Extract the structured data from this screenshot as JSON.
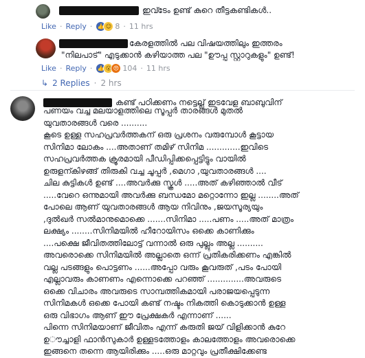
{
  "comment1": {
    "text": "ഇവ്ടേം ഉണ്ട് കുറെ തീട്ടകണ്ടികൾ..",
    "like": "Like",
    "reply": "Reply",
    "reaction_count": "8",
    "time": "11 hrs"
  },
  "comment2": {
    "lines": [
      "കേരളത്തിൽ പല വിഷയത്തിലും ഇത്തരം",
      "\"നിലപാട്\" എടുക്കാൻ കഴിയാത്ത പല \"ഊപ്പ സ്റ്റാറുകളും\" ഉണ്ട്!"
    ],
    "like": "Like",
    "reply": "Reply",
    "reaction_count": "104",
    "time": "11 hrs"
  },
  "replies_link": {
    "label": "2 Replies",
    "time": "2 hrs"
  },
  "comment3": {
    "lines": [
      "കണ്ട് പഠിക്കണം നട്ടെല്ല് ഇടവേള ബാബുവിന്",
      "പണയം വച്ച മലയാളത്തിലെ സൂപ്പർ താരങ്ങൾ മുതൽ",
      "യുവതാരങ്ങൾ വരെ ..........",
      "കൂടെ ഉള്ള സഹപ്രവർത്തകന് ഒരു പ്രശനം വരുമ്പോൾ കൂട്ടായ",
      "സിനിമാ ലോകം ....അതാണ് തമിഴ് സിനിമ .............ഇവിടെ",
      "സഹപ്രവർത്തക ക്രൂരമായി പീഡിപ്പിക്കപ്പെട്ടിട്ടും വായിൽ",
      "ഉരുളന്കിഴങ്ങ് തിരുകി വച്ച ചൂപ്പർ ,മെഗാ ,യുവതാരങ്ങൾ ....",
      "ചില കുട്ടികൾ ഉണ്ട് ....അവർക്കു സ്കൂൾ .....അത് കഴിഞ്ഞാൽ വീട്",
      ".....വേറെ ഒന്നുമായി അവർക്കു ബന്ധമോ മറ്റൊന്നോ ഇല്ല ........അത്",
      "പോലെ ആണ് യുവതാരങ്ങൾ ആയ നിവിനും ,ജയസൂര്യയും",
      ",ദുൽഖർ സൽമാനുമൊക്കെ .......സിനിമാ .....പണം .....അത് മാത്രം",
      "ലക്ഷ്യം ........സിനിമയിൽ ഹീറോയിസം ഒക്കെ കാണിക്കും",
      "....പക്ഷെ ജീവിതത്തിലോട്ട് വന്നാൽ ഒരു പുല്ലും അല്ല ..........",
      "അവരൊക്കെ സിനിമയിൽ അല്ലാതെ ഒന്ന് പ്രതികരിക്കണം എങ്കിൽ",
      "വല്ല പടങ്ങളും പൊട്ടണം ......അപ്പോ വരും കൂവരുത് ,പടം പോയി",
      "എല്ലാവരും കാണണം എന്നൊക്കെ പറഞ്ഞ് ..............അവരുടെ",
      "ഒക്കെ വിചാരം അവരുടെ സാമ്പത്തികമായി പരാജയപ്പെടുന്ന",
      "സിനിമകൾ ഒക്കെ പോയി കണ്ട് നഷ്ടം നികത്തി കൊടുക്കാൻ ഉള്ള",
      "ഒരു വിഭാഗം ആണ് ഈ പ്രേക്ഷകർ എന്നാണ് ......",
      "പിന്നെ സിനിമയാണ് ജീവിതം എന്ന് കരുതി ജയ് വിളിക്കാൻ കുറേ",
      "ഉൗച്ചാളി ഫാൻസുകാർ ഉള്ളടത്തോളം കാലത്തോളം അവരൊക്കെ",
      "ഇങ്ങനെ തന്നെ ആയിരിക്കും .....ഒരു മാറ്റവും പ്രതീക്ഷിക്കേണ്ട"
    ]
  }
}
